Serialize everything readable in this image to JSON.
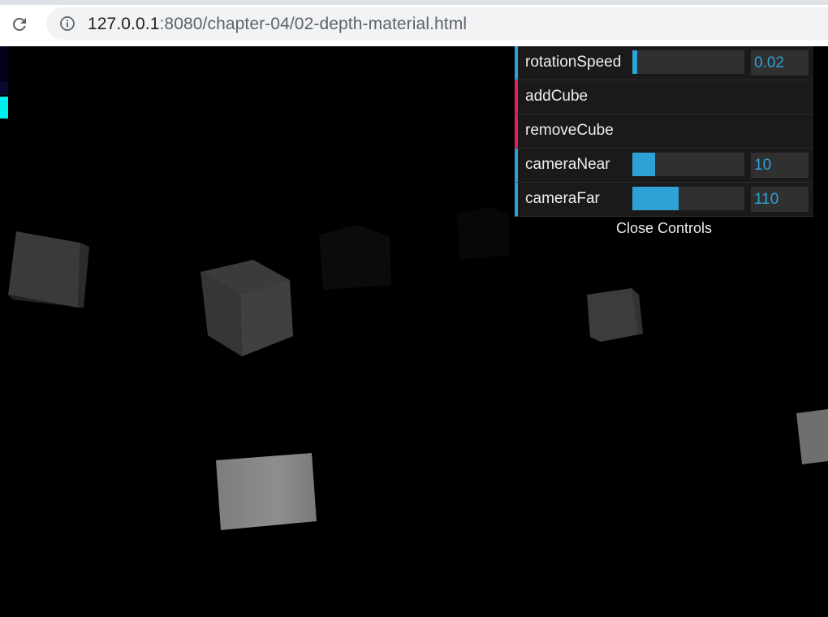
{
  "browser": {
    "url_host": "127.0.0.1",
    "url_rest": ":8080/chapter-04/02-depth-material.html",
    "icons": {
      "reload": "reload-icon",
      "info": "info-icon"
    }
  },
  "controls": {
    "rows": [
      {
        "label": "rotationSpeed",
        "type": "slider",
        "value": "0.02",
        "fill": 0.04
      },
      {
        "label": "addCube",
        "type": "function"
      },
      {
        "label": "removeCube",
        "type": "function"
      },
      {
        "label": "cameraNear",
        "type": "slider",
        "value": "10",
        "fill": 0.2
      },
      {
        "label": "cameraFar",
        "type": "slider",
        "value": "110",
        "fill": 0.41
      }
    ],
    "close_label": "Close Controls",
    "colors": {
      "number": "#2fa1d6",
      "function": "#e61d5f"
    }
  }
}
